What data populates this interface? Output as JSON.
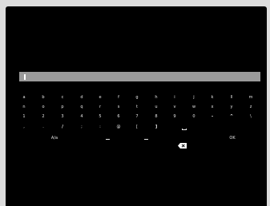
{
  "input": {
    "value": ""
  },
  "keyboard": {
    "rows": [
      [
        "a",
        "b",
        "c",
        "d",
        "e",
        "f",
        "g",
        "h",
        "i",
        "j",
        "k",
        "l",
        "m"
      ],
      [
        "n",
        "o",
        "p",
        "q",
        "r",
        "s",
        "t",
        "u",
        "v",
        "w",
        "x",
        "y",
        "z"
      ],
      [
        "1",
        "2",
        "3",
        "4",
        "5",
        "6",
        "7",
        "8",
        "9",
        "0",
        "-",
        "^",
        "\\"
      ],
      [
        ",",
        ".",
        "/",
        ";",
        ":",
        "@",
        "[",
        "]"
      ]
    ],
    "case_toggle_label": "A/a",
    "ok_label": "OK",
    "icons": {
      "space": "space-icon",
      "left": "cursor-left-icon",
      "right": "cursor-right-icon",
      "backspace": "backspace-icon"
    }
  }
}
